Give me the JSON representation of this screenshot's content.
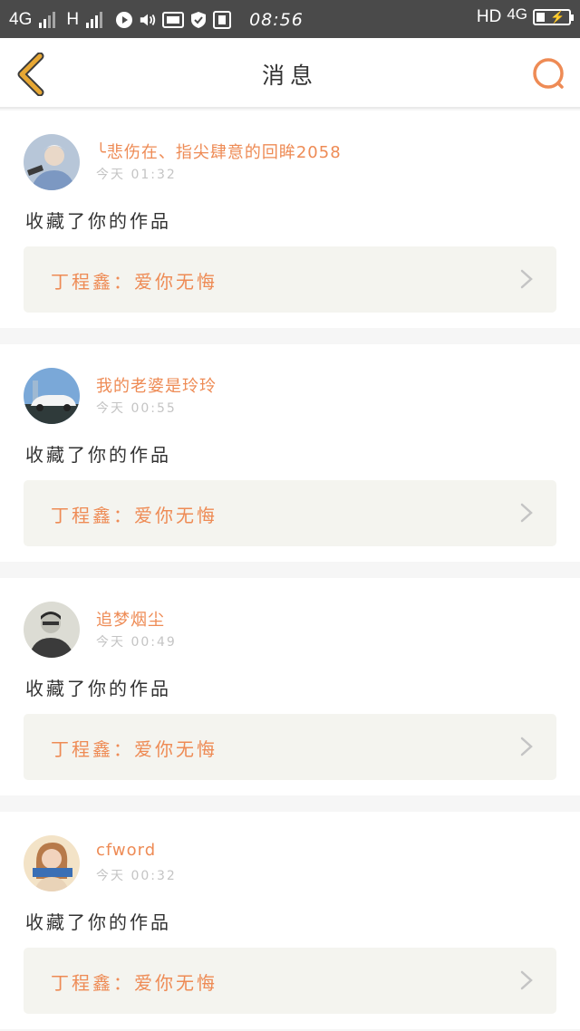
{
  "status_bar": {
    "network_1": "4G",
    "network_2": "H",
    "time": "08:56",
    "hd_label": "HD",
    "network_right": "4G"
  },
  "header": {
    "title": "消息",
    "back_icon": "chevron-left-icon",
    "search_icon": "search-icon"
  },
  "colors": {
    "accent": "#ee8b55",
    "back_arrow": "#e7a733",
    "statusbar": "#4a4a4a",
    "quote_bg": "#f4f4ef"
  },
  "notifications": [
    {
      "username": "╰悲伤在、指尖肆意的回眸2058",
      "time": "今天 01:32",
      "action": "收藏了你的作品",
      "work": "丁程鑫：爱你无悔"
    },
    {
      "username": "我的老婆是玲玲",
      "time": "今天 00:55",
      "action": "收藏了你的作品",
      "work": "丁程鑫：爱你无悔"
    },
    {
      "username": "追梦烟尘",
      "time": "今天 00:49",
      "action": "收藏了你的作品",
      "work": "丁程鑫：爱你无悔"
    },
    {
      "username": "cfword",
      "time": "今天 00:32",
      "action": "收藏了你的作品",
      "work": "丁程鑫：爱你无悔"
    }
  ]
}
